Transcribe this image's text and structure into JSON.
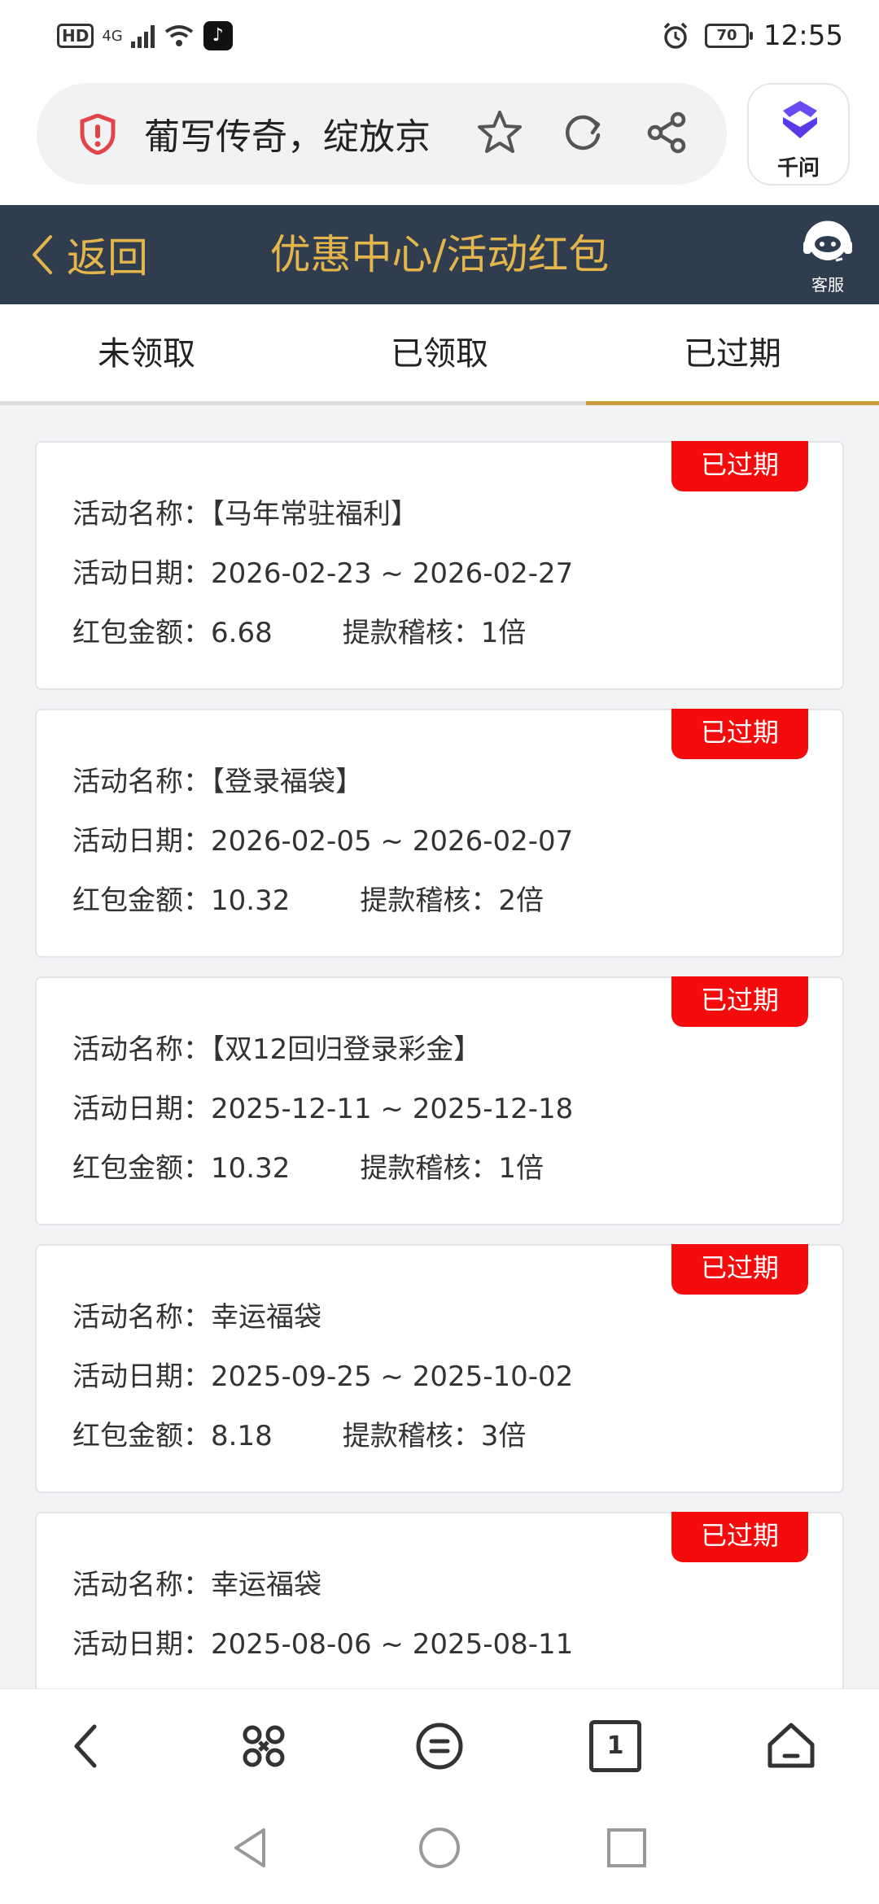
{
  "status_bar": {
    "hd": "HD",
    "network": "4G",
    "battery": "70",
    "time": "12:55"
  },
  "browser": {
    "url_title": "葡写传奇，绽放京",
    "assistant_label": "千问"
  },
  "header": {
    "back_label": "返回",
    "title": "优惠中心/活动红包",
    "service_label": "客服"
  },
  "tabs": [
    {
      "label": "未领取",
      "active": false
    },
    {
      "label": "已领取",
      "active": false
    },
    {
      "label": "已过期",
      "active": true
    }
  ],
  "coupons": [
    {
      "badge": "已过期",
      "name": "活动名称：【马年常驻福利】",
      "date": "活动日期：2026-02-23 ~ 2026-02-27",
      "amount": "红包金额：6.68",
      "audit": "提款稽核：1倍"
    },
    {
      "badge": "已过期",
      "name": "活动名称：【登录福袋】",
      "date": "活动日期：2026-02-05 ~ 2026-02-07",
      "amount": "红包金额：10.32",
      "audit": "提款稽核：2倍"
    },
    {
      "badge": "已过期",
      "name": "活动名称：【双12回归登录彩金】",
      "date": "活动日期：2025-12-11 ~ 2025-12-18",
      "amount": "红包金额：10.32",
      "audit": "提款稽核：1倍"
    },
    {
      "badge": "已过期",
      "name": "活动名称：幸运福袋",
      "date": "活动日期：2025-09-25 ~ 2025-10-02",
      "amount": "红包金额：8.18",
      "audit": "提款稽核：3倍"
    },
    {
      "badge": "已过期",
      "name": "活动名称：幸运福袋",
      "date": "活动日期：2025-08-06 ~ 2025-08-11",
      "amount": "",
      "audit": ""
    }
  ],
  "bottom_nav": {
    "tab_count": "1"
  },
  "colors": {
    "header_bg": "#2f3d4f",
    "accent_gold": "#e4b54b",
    "badge_red": "#f40c0c",
    "tab_underline": "#c89b3c"
  }
}
